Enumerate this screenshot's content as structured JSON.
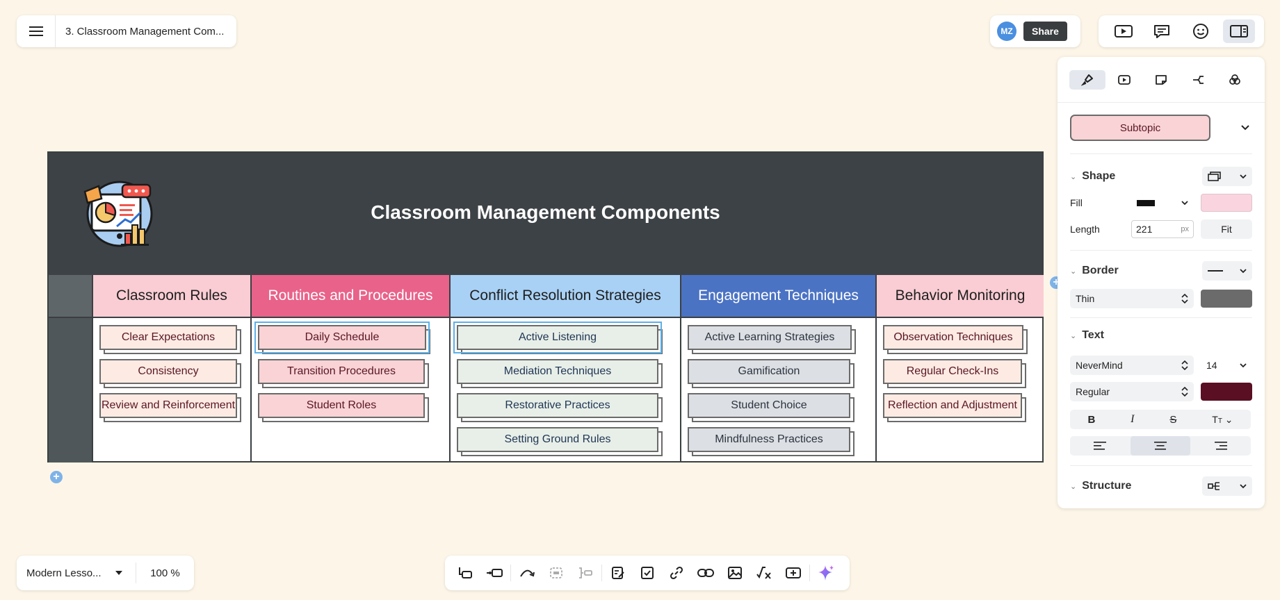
{
  "header": {
    "doc_title": "3. Classroom Management Com...",
    "avatar_initials": "MZ",
    "share_label": "Share"
  },
  "board": {
    "title": "Classroom Management Components",
    "columns": [
      {
        "title": "Classroom Rules",
        "color": "#f9cdd3",
        "text_color": "#1e1e1e",
        "node_bg": "#fdebe3",
        "node_color": "#5a1626",
        "items": [
          "Clear Expectations",
          "Consistency",
          "Review and Reinforcement"
        ]
      },
      {
        "title": "Routines and Procedures",
        "color": "#e9628a",
        "text_color": "#ffffff",
        "node_bg": "#f9d3d5",
        "node_color": "#5a1626",
        "items": [
          "Daily Schedule",
          "Transition Procedures",
          "Student Roles"
        ]
      },
      {
        "title": "Conflict Resolution Strategies",
        "color": "#a9d1f5",
        "text_color": "#1e1e1e",
        "node_bg": "#e8efe8",
        "node_color": "#1f3554",
        "items": [
          "Active Listening",
          "Mediation Techniques",
          "Restorative Practices",
          "Setting Ground Rules"
        ]
      },
      {
        "title": "Engagement Techniques",
        "color": "#4b73c4",
        "text_color": "#ffffff",
        "node_bg": "#dcdfe3",
        "node_color": "#2c3440",
        "items": [
          "Active Learning Strategies",
          "Gamification",
          "Student Choice",
          "Mindfulness Practices"
        ]
      },
      {
        "title": "Behavior Monitoring",
        "color": "#f9cdd3",
        "text_color": "#1e1e1e",
        "node_bg": "#fdebe3",
        "node_color": "#5a1626",
        "items": [
          "Observation Techniques",
          "Regular Check-Ins",
          "Reflection and Adjustment"
        ]
      }
    ]
  },
  "panel": {
    "style_preview": "Subtopic",
    "shape": {
      "section": "Shape",
      "fill_label": "Fill",
      "length_label": "Length",
      "length_value": "221",
      "length_unit": "px",
      "fit_label": "Fit",
      "fill_color": "#fad4df"
    },
    "border": {
      "section": "Border",
      "thickness": "Thin",
      "color": "#6b6b6b"
    },
    "text": {
      "section": "Text",
      "font": "NeverMind",
      "size": "14",
      "weight": "Regular",
      "color": "#5a0f22"
    },
    "structure": {
      "section": "Structure"
    }
  },
  "footer": {
    "theme_name": "Modern Lesso...",
    "zoom": "100 %"
  },
  "colors": {
    "accent": "#4a8fe0",
    "selection": "#5bb0e8",
    "canvas": "#fdf6e8",
    "dark": "#3d4246"
  }
}
